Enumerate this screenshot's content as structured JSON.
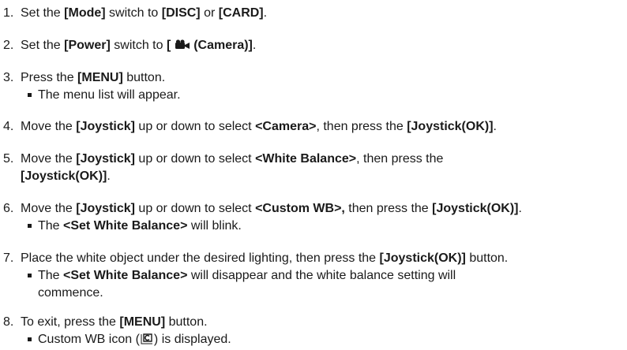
{
  "steps": [
    {
      "num": "1.",
      "parts": [
        {
          "t": "Set the "
        },
        {
          "t": "[Mode]",
          "b": true
        },
        {
          "t": " switch to "
        },
        {
          "t": "[DISC]",
          "b": true
        },
        {
          "t": " or "
        },
        {
          "t": "[CARD]",
          "b": true
        },
        {
          "t": "."
        }
      ]
    },
    {
      "num": "2.",
      "parts": [
        {
          "t": "Set the "
        },
        {
          "t": "[Power]",
          "b": true
        },
        {
          "t": " switch to "
        },
        {
          "t": "[",
          "b": true
        },
        {
          "icon": "camera-icon"
        },
        {
          "t": " (Camera)]",
          "b": true
        },
        {
          "t": "."
        }
      ]
    },
    {
      "num": "3.",
      "parts": [
        {
          "t": "Press the "
        },
        {
          "t": "[MENU]",
          "b": true
        },
        {
          "t": " button."
        }
      ],
      "bullets": [
        [
          {
            "t": "The menu list will appear."
          }
        ]
      ]
    },
    {
      "num": "4.",
      "parts": [
        {
          "t": "Move the "
        },
        {
          "t": "[Joystick]",
          "b": true
        },
        {
          "t": " up or down to select "
        },
        {
          "t": "<Camera>",
          "b": true
        },
        {
          "t": ", then press the "
        },
        {
          "t": "[Joystick(OK)]",
          "b": true
        },
        {
          "t": "."
        }
      ]
    },
    {
      "num": "5.",
      "parts": [
        {
          "t": "Move the "
        },
        {
          "t": "[Joystick]",
          "b": true
        },
        {
          "t": " up or down to select "
        },
        {
          "t": "<White Balance>",
          "b": true
        },
        {
          "t": ", then press the"
        }
      ],
      "cont": [
        {
          "t": "[Joystick(OK)]",
          "b": true
        },
        {
          "t": "."
        }
      ]
    },
    {
      "num": "6.",
      "parts": [
        {
          "t": "Move the "
        },
        {
          "t": "[Joystick]",
          "b": true
        },
        {
          "t": " up or down to select "
        },
        {
          "t": "<Custom WB>,",
          "b": true
        },
        {
          "t": " then press the "
        },
        {
          "t": "[Joystick(OK)]",
          "b": true
        },
        {
          "t": "."
        }
      ],
      "bullets": [
        [
          {
            "t": "The "
          },
          {
            "t": "<Set White Balance>",
            "b": true
          },
          {
            "t": " will blink."
          }
        ]
      ]
    },
    {
      "num": "7.",
      "parts": [
        {
          "t": "Place the white object under the desired lighting, then press the "
        },
        {
          "t": "[Joystick(OK)]",
          "b": true
        },
        {
          "t": " button."
        }
      ],
      "bullets": [
        [
          {
            "t": "The "
          },
          {
            "t": "<Set White Balance>",
            "b": true
          },
          {
            "t": " will disappear and the white balance setting will"
          }
        ],
        [
          {
            "t": "commence.",
            "nobullet": true
          }
        ]
      ]
    },
    {
      "num": "8.",
      "parts": [
        {
          "t": "To exit, press the "
        },
        {
          "t": "[MENU]",
          "b": true
        },
        {
          "t": " button."
        }
      ],
      "bullets": [
        [
          {
            "t": "Custom WB icon ("
          },
          {
            "icon": "custom-wb-icon"
          },
          {
            "t": ") is displayed."
          }
        ]
      ]
    }
  ]
}
